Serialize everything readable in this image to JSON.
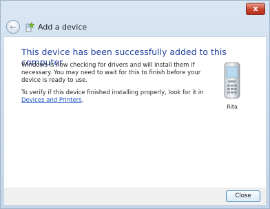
{
  "window": {
    "title_close_glyph": "x"
  },
  "header": {
    "title": "Add a device",
    "back_glyph": "←"
  },
  "main": {
    "heading": "This device has been successfully added to this computer",
    "description": "Windows is now checking for drivers and will install them if necessary. You may need to wait for this to finish before your device is ready to use.",
    "verify_text": "To verify if this device finished installing properly, look for it in",
    "verify_link": "Devices and Printers",
    "verify_end": "."
  },
  "device": {
    "name": "Rita",
    "icon": "mobile-phone-icon"
  },
  "footer": {
    "close_label": "Close"
  },
  "colors": {
    "heading": "#1e3e9e",
    "link": "#1a52c0",
    "close_button_red": "#c8432c",
    "frame": "#c5d6ea"
  }
}
